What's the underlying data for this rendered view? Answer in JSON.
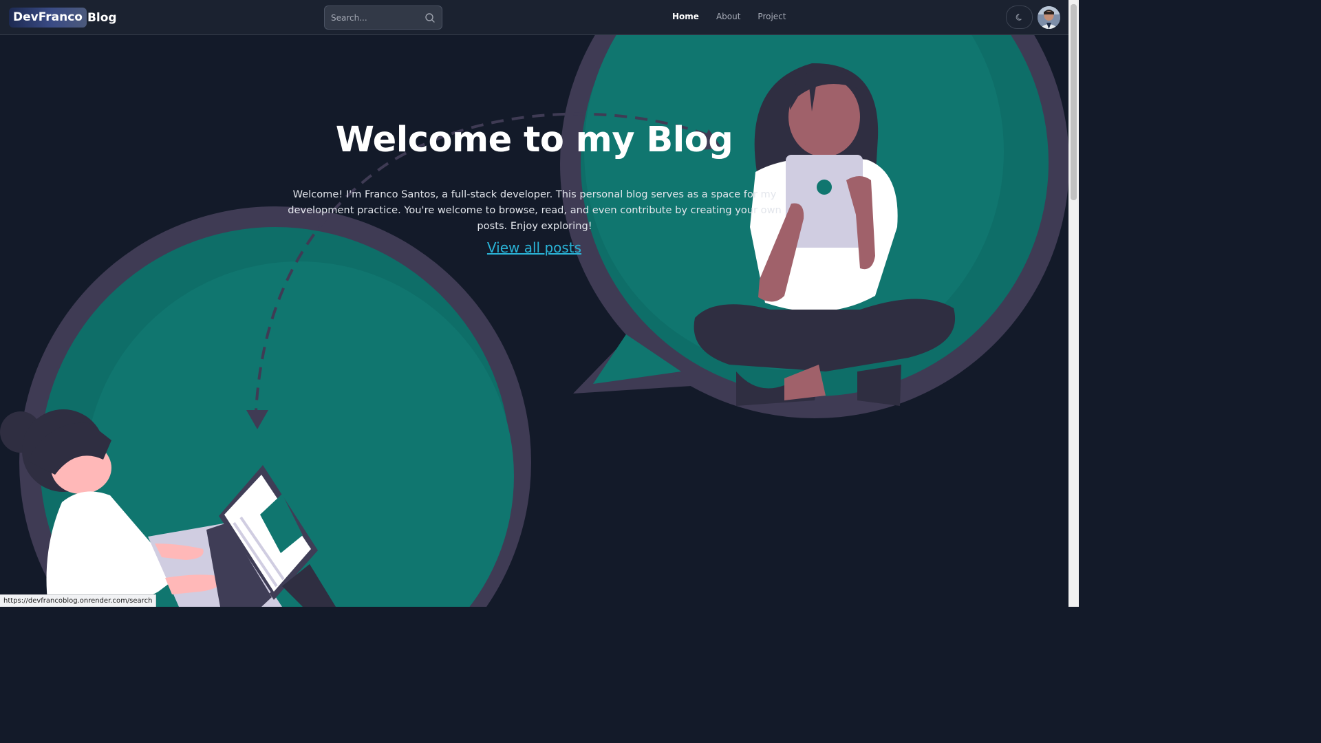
{
  "brand": {
    "highlight": "DevFranco",
    "suffix": "Blog"
  },
  "search": {
    "placeholder": "Search..."
  },
  "nav": {
    "items": [
      {
        "label": "Home",
        "active": true
      },
      {
        "label": "About",
        "active": false
      },
      {
        "label": "Project",
        "active": false
      }
    ]
  },
  "hero": {
    "title": "Welcome to my Blog",
    "intro": "Welcome! I'm Franco Santos, a full-stack developer. This personal blog serves as a space for my development practice. You're welcome to browse, read, and even contribute by creating your own posts. Enjoy exploring!",
    "cta": "View all posts"
  },
  "status_bar": {
    "url": "https://devfrancoblog.onrender.com/search"
  },
  "icons": {
    "search": "search-icon",
    "theme_toggle": "moon-icon",
    "avatar": "avatar"
  },
  "colors": {
    "background": "#131a29",
    "navbar": "#1b2230",
    "accent_link": "#2ab4d8",
    "bubble_teal": "#10766f",
    "bubble_border": "#3f3b54"
  }
}
